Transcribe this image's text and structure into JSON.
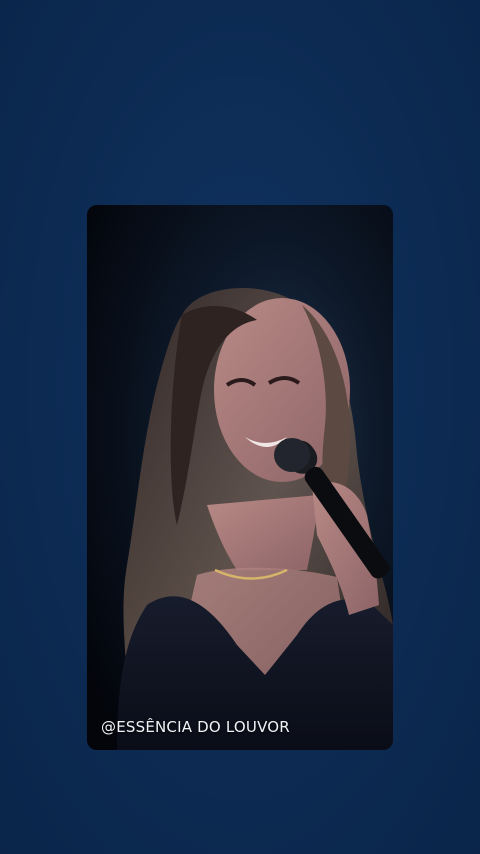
{
  "page": {
    "background_color": "#0d2d55"
  },
  "media": {
    "kind": "video-frame",
    "subject": "singer-with-microphone",
    "watermark": "@ESSÊNCIA DO LOUVOR"
  }
}
